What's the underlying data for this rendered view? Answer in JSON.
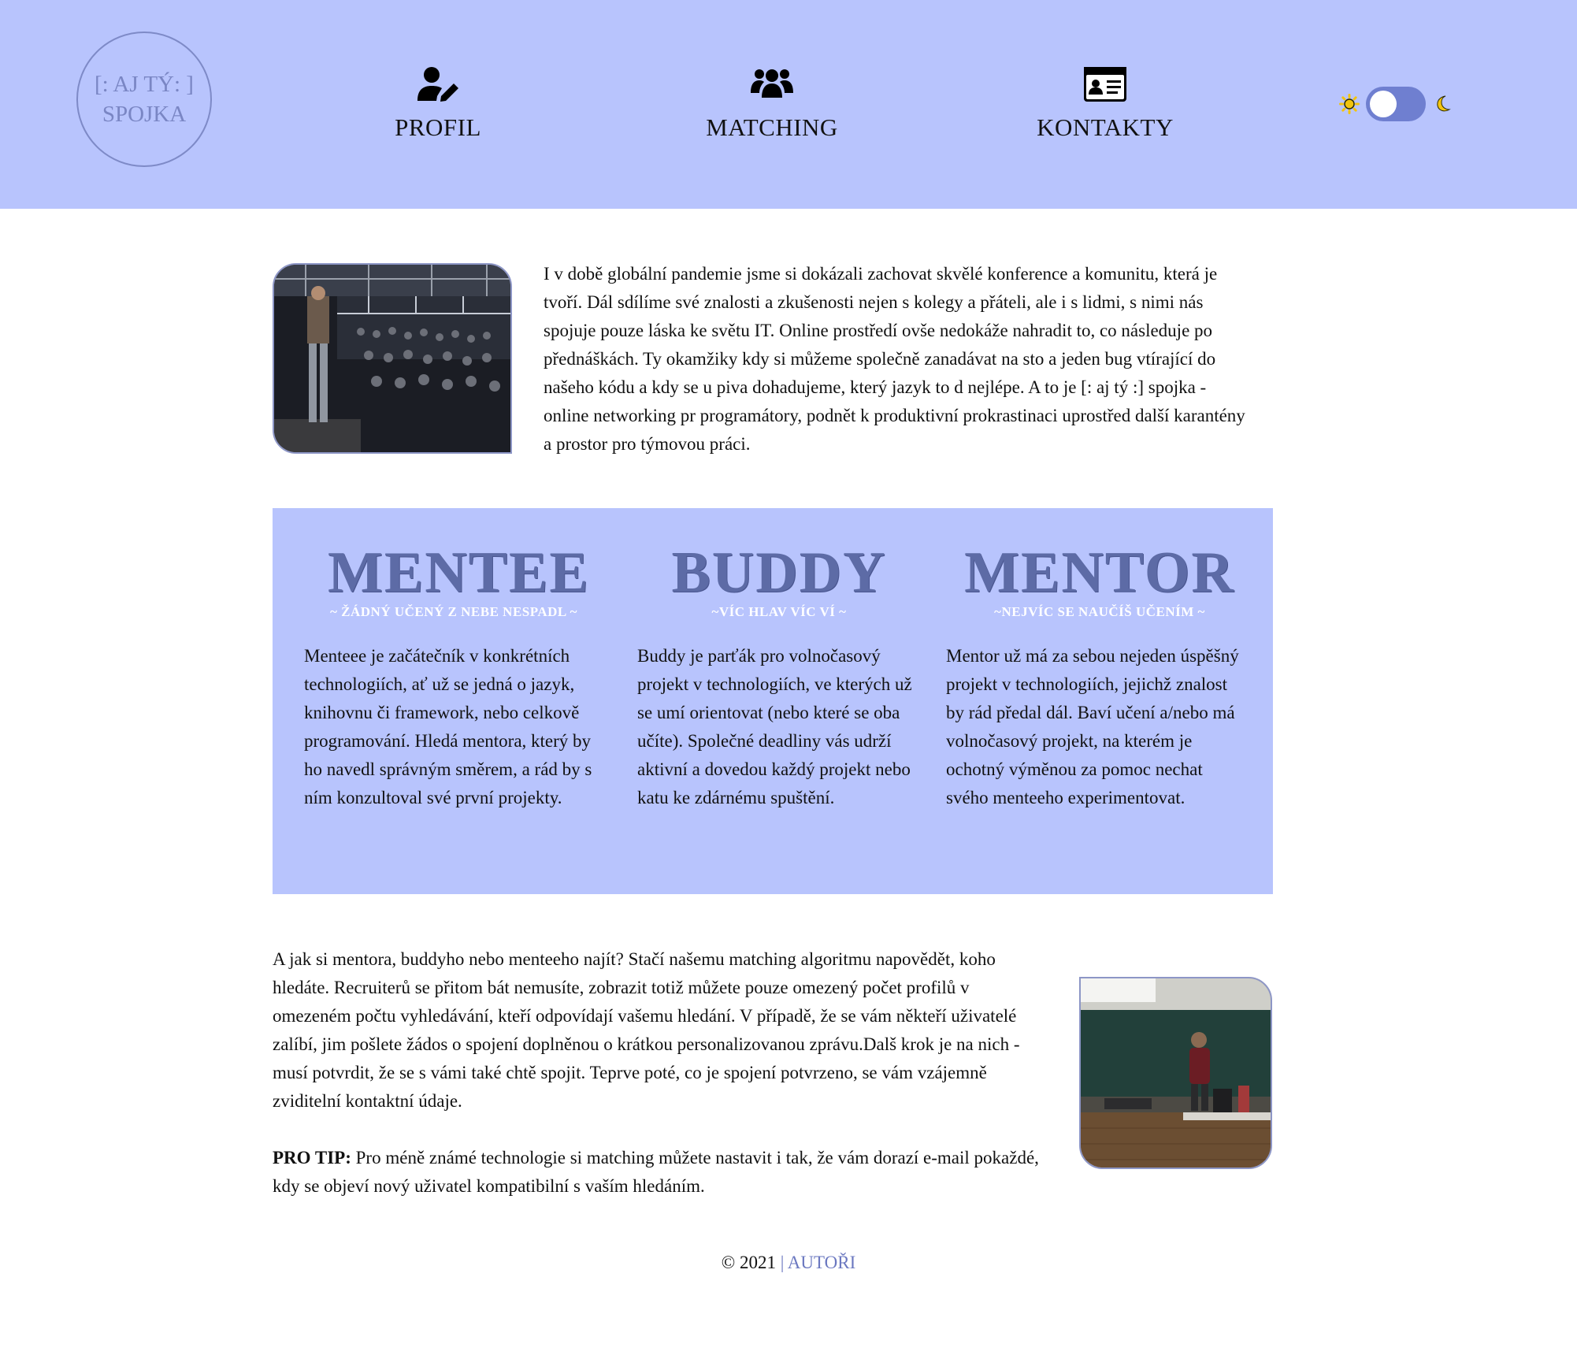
{
  "header": {
    "logo": {
      "line1": "[: AJ TÝ: ]",
      "line2": "SPOJKA"
    },
    "nav": [
      {
        "label": "PROFIL",
        "icon": "user-edit-icon"
      },
      {
        "label": "MATCHING",
        "icon": "users-icon"
      },
      {
        "label": "KONTAKTY",
        "icon": "id-card-icon"
      }
    ],
    "theme_toggle": {
      "light_icon": "sun-icon",
      "dark_icon": "moon-icon",
      "state": "light"
    }
  },
  "intro": {
    "text": "I v době globální pandemie jsme si dokázali zachovat skvělé konference a komunitu, která je tvoří. Dál sdílíme své znalosti a zkušenosti nejen s kolegy a přáteli, ale i s lidmi, s nimi nás spojuje pouze láska ke světu IT. Online prostředí ovše nedokáže nahradit to, co následuje po přednáškách. Ty okamžiky kdy si můžeme společně zanadávat na sto a jeden bug vtírající do našeho kódu a kdy se u piva dohadujeme, který jazyk to d nejlépe. A to je [: aj tý :] spojka - online networking pr programátory, podnět k produktivní prokrastinaci uprostřed další karantény a prostor pro týmovou práci."
  },
  "roles": [
    {
      "title": "MENTEE",
      "motto": "~ ŽÁDNÝ UČENÝ Z NEBE NESPADL ~",
      "description": "Menteee je začátečník v konkrétních technologiích, ať už se jedná o jazyk, knihovnu či framework, nebo celkově programování. Hledá mentora, který by ho navedl správným směrem, a rád by s ním konzultoval své první projekty."
    },
    {
      "title": "BUDDY",
      "motto": "~VÍC HLAV VÍC VÍ ~",
      "description": "Buddy je parťák pro volnočasový projekt v technologiích, ve kterých už se umí orientovat (nebo které se oba učíte). Společné deadliny vás udrží aktivní a dovedou každý projekt nebo katu ke zdárnému spuštění."
    },
    {
      "title": "MENTOR",
      "motto": "~NEJVÍC SE NAUČÍŠ UČENÍM ~",
      "description": "Mentor už má za sebou nejeden úspěšný projekt v technologiích, jejichž znalost by rád předal dál. Baví učení a/nebo má volnočasový projekt, na kterém je ochotný výměnou za pomoc nechat svého menteeho experimentovat."
    }
  ],
  "matching": {
    "text": "A jak si mentora, buddyho nebo menteeho najít? Stačí našemu matching algoritmu napovědět, koho hledáte. Recruiterů se přitom bát nemusíte, zobrazit totiž můžete pouze omezený počet profilů v omezeném počtu vyhledávání, kteří odpovídají vašemu hledání. V případě, že se vám někteří uživatelé zalíbí, jim pošlete žádos o spojení doplněnou o krátkou personalizovanou zprávu.Dalš krok je na nich - musí potvrdit, že se s vámi také chtě spojit. Teprve poté, co je spojení potvrzeno, se vám vzájemně zviditelní kontaktní údaje.",
    "protip_label": "PRO TIP:",
    "protip_text": " Pro méně známé technologie si matching můžete nastavit i tak, že vám dorazí e-mail pokaždé, kdy se objeví nový uživatel kompatibilní s vaším hledáním."
  },
  "footer": {
    "copyright": "© 2021",
    "separator": " | ",
    "link": "AUTOŘI"
  },
  "colors": {
    "header_bg": "#b8c4fd",
    "accent": "#6b78c0",
    "role_title": "#5d6ba6"
  }
}
